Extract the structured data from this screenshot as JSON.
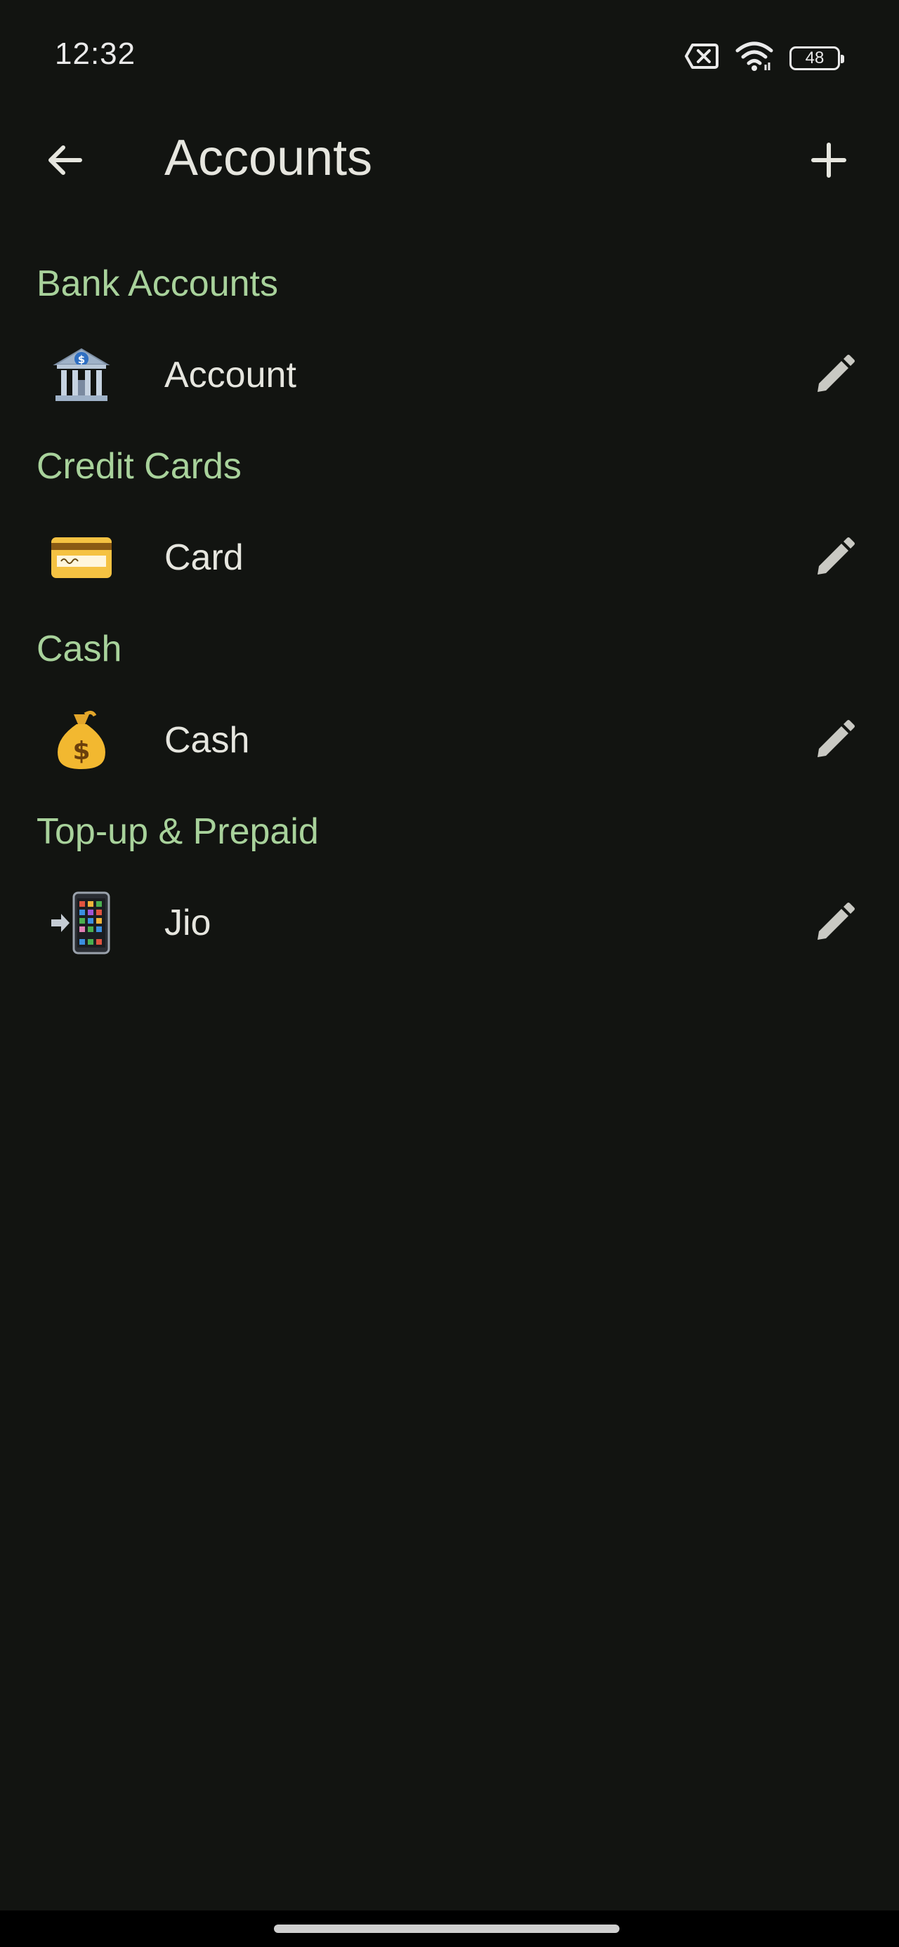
{
  "status_bar": {
    "time": "12:32",
    "battery": "48"
  },
  "app_bar": {
    "title": "Accounts"
  },
  "sections": [
    {
      "title": "Bank Accounts",
      "accounts": [
        {
          "name": "Account",
          "icon": "bank-emoji"
        }
      ]
    },
    {
      "title": "Credit Cards",
      "accounts": [
        {
          "name": "Card",
          "icon": "credit-card-emoji"
        }
      ]
    },
    {
      "title": "Cash",
      "accounts": [
        {
          "name": "Cash",
          "icon": "money-bag-emoji"
        }
      ]
    },
    {
      "title": "Top-up & Prepaid",
      "accounts": [
        {
          "name": "Jio",
          "icon": "mobile-arrow-emoji"
        }
      ]
    }
  ],
  "colors": {
    "background": "#121411",
    "section_header": "#a8d29b",
    "text": "#e6e6df",
    "icon": "#c9c9c3"
  }
}
